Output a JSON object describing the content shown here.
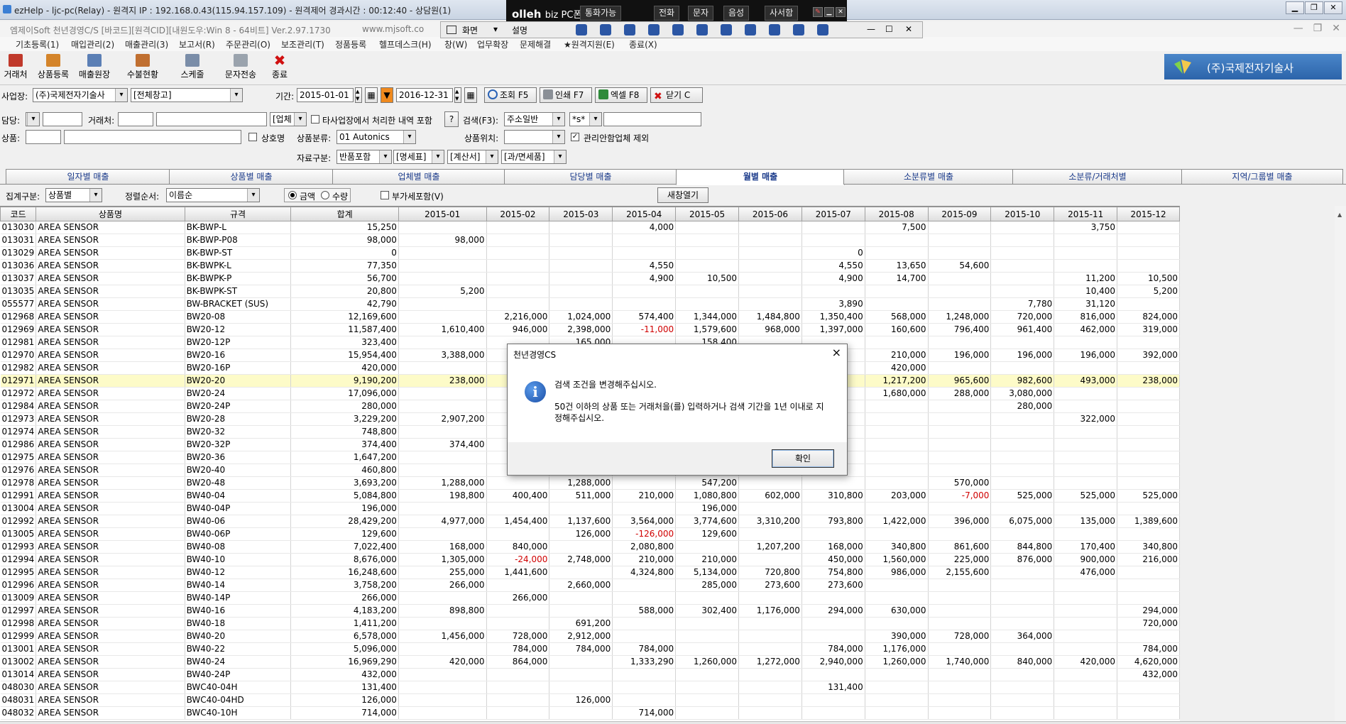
{
  "remote": {
    "title": "ezHelp - ljc-pc(Relay) - 원격지 IP : 192.168.0.43(115.94.157.109) - 원격제어 경과시간 : 00:12:40 - 상담원(1)"
  },
  "olleh": {
    "brand": "olleh",
    "brand_sub": "biz PC폰",
    "call_status": "통화가능",
    "phone": "전화",
    "sms": "문자",
    "voice": "음성",
    "directory": "사서함"
  },
  "rc_bar": {
    "screen": "화면",
    "settings": "설명"
  },
  "app": {
    "title": "엠제이Soft 천년경영C/S [바코드][원격CID][내원도우:Win 8 - 64비트] Ver.2.97.1730",
    "url": "www.mjsoft.co",
    "menu": [
      "기초등록(1)",
      "매입관리(2)",
      "매출관리(3)",
      "보고서(R)",
      "주문관리(O)",
      "보조관리(T)",
      "정품등록",
      "헬프데스크(H)",
      "창(W)",
      "업무확장",
      "문제해결",
      "★원격지원(E)",
      "종료(X)"
    ]
  },
  "toolbar": {
    "items": [
      "거래처",
      "상품등록",
      "매출원장",
      "수불현황",
      "스케줄",
      "문자전송",
      "종료"
    ],
    "company": "(주)국제전자기술사"
  },
  "filters": {
    "business_label": "사업장:",
    "business_value": "(주)국제전자기술사",
    "warehouse_value": "[전체창고]",
    "period_label": "기간:",
    "date_from": "2015-01-01",
    "date_to": "2016-12-31",
    "search_btn": "조회 F5",
    "print_btn": "인쇄 F7",
    "excel_btn": "엑셀 F8",
    "close_btn": "닫기 C",
    "manager_label": "담당:",
    "client_label": "거래처:",
    "vendor_dd": "[업체",
    "other_biz": "타사업장에서 처리한 내역 포함",
    "help_q": "?",
    "search_label": "검색(F3):",
    "search_mode": "주소일반",
    "search_op": "*s*",
    "product_label": "상품:",
    "product_name_chk": "상호명",
    "category_label": "상품분류:",
    "category_value": "01 Autonics",
    "location_label": "상품위치:",
    "exclude_label": "관리안함업체 제외",
    "source_label": "자료구분:",
    "source_values": [
      "반품포함",
      "[명세표]",
      "[계산서]",
      "[과/면세품]"
    ]
  },
  "tabs": [
    "일자별 매출",
    "상품별 매출",
    "업체별 매출",
    "담당별 매출",
    "월별 매출",
    "소분류별 매출",
    "소분류/거래처별",
    "지역/그룹별 매출"
  ],
  "options": {
    "group_label": "집계구분:",
    "group_value": "상품별",
    "sort_label": "정렬순서:",
    "sort_value": "이름순",
    "amount": "금액",
    "quantity": "수량",
    "vat_label": "부가세포함(V)",
    "new_window": "새창열기"
  },
  "grid": {
    "headers": [
      "코드",
      "상품명",
      "규격",
      "합계",
      "2015-01",
      "2015-02",
      "2015-03",
      "2015-04",
      "2015-05",
      "2015-06",
      "2015-07",
      "2015-08",
      "2015-09",
      "2015-10",
      "2015-11",
      "2015-12"
    ],
    "highlight_row": 12,
    "rows": [
      [
        "013030",
        "AREA SENSOR",
        "BK-BWP-L",
        "15,250",
        "",
        "",
        "",
        "4,000",
        "",
        "",
        "",
        "7,500",
        "",
        "",
        "3,750",
        ""
      ],
      [
        "013031",
        "AREA SENSOR",
        "BK-BWP-P08",
        "98,000",
        "98,000",
        "",
        "",
        "",
        "",
        "",
        "",
        "",
        "",
        "",
        "",
        ""
      ],
      [
        "013029",
        "AREA SENSOR",
        "BK-BWP-ST",
        "0",
        "",
        "",
        "",
        "",
        "",
        "",
        "0",
        "",
        "",
        "",
        "",
        ""
      ],
      [
        "013036",
        "AREA SENSOR",
        "BK-BWPK-L",
        "77,350",
        "",
        "",
        "",
        "4,550",
        "",
        "",
        "4,550",
        "13,650",
        "54,600",
        "",
        "",
        ""
      ],
      [
        "013037",
        "AREA SENSOR",
        "BK-BWPK-P",
        "56,700",
        "",
        "",
        "",
        "4,900",
        "10,500",
        "",
        "4,900",
        "14,700",
        "",
        "",
        "11,200",
        "10,500"
      ],
      [
        "013035",
        "AREA SENSOR",
        "BK-BWPK-ST",
        "20,800",
        "5,200",
        "",
        "",
        "",
        "",
        "",
        "",
        "",
        "",
        "",
        "10,400",
        "5,200"
      ],
      [
        "055577",
        "AREA SENSOR",
        "BW-BRACKET (SUS)",
        "42,790",
        "",
        "",
        "",
        "",
        "",
        "",
        "3,890",
        "",
        "",
        "7,780",
        "31,120",
        ""
      ],
      [
        "012968",
        "AREA SENSOR",
        "BW20-08",
        "12,169,600",
        "",
        "2,216,000",
        "1,024,000",
        "574,400",
        "1,344,000",
        "1,484,800",
        "1,350,400",
        "568,000",
        "1,248,000",
        "720,000",
        "816,000",
        "824,000"
      ],
      [
        "012969",
        "AREA SENSOR",
        "BW20-12",
        "11,587,400",
        "1,610,400",
        "946,000",
        "2,398,000",
        "-11,000",
        "1,579,600",
        "968,000",
        "1,397,000",
        "160,600",
        "796,400",
        "961,400",
        "462,000",
        "319,000"
      ],
      [
        "012981",
        "AREA SENSOR",
        "BW20-12P",
        "323,400",
        "",
        "",
        "165,000",
        "",
        "158,400",
        "",
        "",
        "",
        "",
        "",
        "",
        ""
      ],
      [
        "012970",
        "AREA SENSOR",
        "BW20-16",
        "15,954,400",
        "3,388,000",
        "",
        "",
        "",
        "",
        "",
        "",
        "210,000",
        "196,000",
        "196,000",
        "196,000",
        "392,000"
      ],
      [
        "012982",
        "AREA SENSOR",
        "BW20-16P",
        "420,000",
        "",
        "",
        "",
        "",
        "",
        "",
        "",
        "420,000",
        "",
        "",
        "",
        ""
      ],
      [
        "012971",
        "AREA SENSOR",
        "BW20-20",
        "9,190,200",
        "238,000",
        "",
        "",
        "",
        "",
        "",
        "",
        "1,217,200",
        "965,600",
        "982,600",
        "493,000",
        "238,000"
      ],
      [
        "012972",
        "AREA SENSOR",
        "BW20-24",
        "17,096,000",
        "",
        "",
        "",
        "",
        "",
        "",
        "",
        "1,680,000",
        "288,000",
        "3,080,000",
        "",
        ""
      ],
      [
        "012984",
        "AREA SENSOR",
        "BW20-24P",
        "280,000",
        "",
        "",
        "",
        "",
        "",
        "",
        "",
        "",
        "",
        "280,000",
        "",
        ""
      ],
      [
        "012973",
        "AREA SENSOR",
        "BW20-28",
        "3,229,200",
        "2,907,200",
        "",
        "",
        "",
        "",
        "",
        "",
        "",
        "",
        "",
        "322,000",
        ""
      ],
      [
        "012974",
        "AREA SENSOR",
        "BW20-32",
        "748,800",
        "",
        "",
        "",
        "",
        "",
        "",
        "",
        "",
        "",
        "",
        "",
        ""
      ],
      [
        "012986",
        "AREA SENSOR",
        "BW20-32P",
        "374,400",
        "374,400",
        "",
        "",
        "",
        "",
        "",
        "",
        "",
        "",
        "",
        "",
        ""
      ],
      [
        "012975",
        "AREA SENSOR",
        "BW20-36",
        "1,647,200",
        "",
        "",
        "",
        "",
        "",
        "",
        "",
        "",
        "",
        "",
        "",
        ""
      ],
      [
        "012976",
        "AREA SENSOR",
        "BW20-40",
        "460,800",
        "",
        "",
        "",
        "",
        "",
        "",
        "",
        "",
        "",
        "",
        "",
        ""
      ],
      [
        "012978",
        "AREA SENSOR",
        "BW20-48",
        "3,693,200",
        "1,288,000",
        "",
        "1,288,000",
        "",
        "547,200",
        "",
        "",
        "",
        "570,000",
        "",
        "",
        ""
      ],
      [
        "012991",
        "AREA SENSOR",
        "BW40-04",
        "5,084,800",
        "198,800",
        "400,400",
        "511,000",
        "210,000",
        "1,080,800",
        "602,000",
        "310,800",
        "203,000",
        "-7,000",
        "525,000",
        "525,000",
        "525,000"
      ],
      [
        "013004",
        "AREA SENSOR",
        "BW40-04P",
        "196,000",
        "",
        "",
        "",
        "",
        "196,000",
        "",
        "",
        "",
        "",
        "",
        "",
        ""
      ],
      [
        "012992",
        "AREA SENSOR",
        "BW40-06",
        "28,429,200",
        "4,977,000",
        "1,454,400",
        "1,137,600",
        "3,564,000",
        "3,774,600",
        "3,310,200",
        "793,800",
        "1,422,000",
        "396,000",
        "6,075,000",
        "135,000",
        "1,389,600"
      ],
      [
        "013005",
        "AREA SENSOR",
        "BW40-06P",
        "129,600",
        "",
        "",
        "126,000",
        "-126,000",
        "129,600",
        "",
        "",
        "",
        "",
        "",
        "",
        ""
      ],
      [
        "012993",
        "AREA SENSOR",
        "BW40-08",
        "7,022,400",
        "168,000",
        "840,000",
        "",
        "2,080,800",
        "",
        "1,207,200",
        "168,000",
        "340,800",
        "861,600",
        "844,800",
        "170,400",
        "340,800"
      ],
      [
        "012994",
        "AREA SENSOR",
        "BW40-10",
        "8,676,000",
        "1,305,000",
        "-24,000",
        "2,748,000",
        "210,000",
        "210,000",
        "",
        "450,000",
        "1,560,000",
        "225,000",
        "876,000",
        "900,000",
        "216,000"
      ],
      [
        "012995",
        "AREA SENSOR",
        "BW40-12",
        "16,248,600",
        "255,000",
        "1,441,600",
        "",
        "4,324,800",
        "5,134,000",
        "720,800",
        "754,800",
        "986,000",
        "2,155,600",
        "",
        "476,000",
        ""
      ],
      [
        "012996",
        "AREA SENSOR",
        "BW40-14",
        "3,758,200",
        "266,000",
        "",
        "2,660,000",
        "",
        "285,000",
        "273,600",
        "273,600",
        "",
        "",
        "",
        "",
        ""
      ],
      [
        "013009",
        "AREA SENSOR",
        "BW40-14P",
        "266,000",
        "",
        "266,000",
        "",
        "",
        "",
        "",
        "",
        "",
        "",
        "",
        "",
        ""
      ],
      [
        "012997",
        "AREA SENSOR",
        "BW40-16",
        "4,183,200",
        "898,800",
        "",
        "",
        "588,000",
        "302,400",
        "1,176,000",
        "294,000",
        "630,000",
        "",
        "",
        "",
        "294,000"
      ],
      [
        "012998",
        "AREA SENSOR",
        "BW40-18",
        "1,411,200",
        "",
        "",
        "691,200",
        "",
        "",
        "",
        "",
        "",
        "",
        "",
        "",
        "720,000"
      ],
      [
        "012999",
        "AREA SENSOR",
        "BW40-20",
        "6,578,000",
        "1,456,000",
        "728,000",
        "2,912,000",
        "",
        "",
        "",
        "",
        "390,000",
        "728,000",
        "364,000",
        "",
        ""
      ],
      [
        "013001",
        "AREA SENSOR",
        "BW40-22",
        "5,096,000",
        "",
        "784,000",
        "784,000",
        "784,000",
        "",
        "",
        "784,000",
        "1,176,000",
        "",
        "",
        "",
        "784,000"
      ],
      [
        "013002",
        "AREA SENSOR",
        "BW40-24",
        "16,969,290",
        "420,000",
        "864,000",
        "",
        "1,333,290",
        "1,260,000",
        "1,272,000",
        "2,940,000",
        "1,260,000",
        "1,740,000",
        "840,000",
        "420,000",
        "4,620,000"
      ],
      [
        "013014",
        "AREA SENSOR",
        "BW40-24P",
        "432,000",
        "",
        "",
        "",
        "",
        "",
        "",
        "",
        "",
        "",
        "",
        "",
        "432,000"
      ],
      [
        "048030",
        "AREA SENSOR",
        "BWC40-04H",
        "131,400",
        "",
        "",
        "",
        "",
        "",
        "",
        "131,400",
        "",
        "",
        "",
        "",
        ""
      ],
      [
        "048031",
        "AREA SENSOR",
        "BWC40-04HD",
        "126,000",
        "",
        "",
        "126,000",
        "",
        "",
        "",
        "",
        "",
        "",
        "",
        "",
        ""
      ],
      [
        "048032",
        "AREA SENSOR",
        "BWC40-10H",
        "714,000",
        "",
        "",
        "",
        "714,000",
        "",
        "",
        "",
        "",
        "",
        "",
        "",
        ""
      ]
    ]
  },
  "dialog": {
    "title": "천년경영CS",
    "close": "×",
    "icon": "info-icon",
    "message1": "검색 조건을 변경해주십시오.",
    "message2": "50건 이하의 상품 또는 거래처을(를) 입력하거나 검색 기간을 1년 이내로 지정해주십시오.",
    "ok": "확인"
  }
}
